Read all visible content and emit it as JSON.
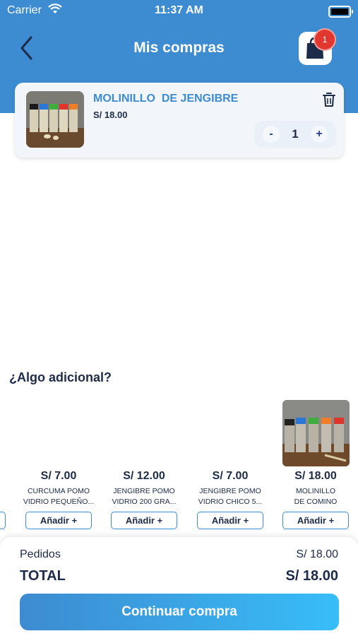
{
  "status_bar": {
    "carrier": "Carrier",
    "time": "11:37 AM"
  },
  "header": {
    "title": "Mis compras",
    "back_icon": "chevron-left-icon",
    "cart_icon": "shopping-bag-icon",
    "cart_count": "1"
  },
  "cart": {
    "items": [
      {
        "name": "MOLINILLO  DE JENGIBRE",
        "price": "S/ 18.00",
        "quantity": "1",
        "decrement": "-",
        "increment": "+"
      }
    ]
  },
  "suggestions": {
    "title": "¿Algo adicional?",
    "add_label": "Añadir +",
    "products": [
      {
        "price": "S/ 7.00",
        "name_line1": "CURCUMA POMO",
        "name_line2": "VIDRIO PEQUEÑO..."
      },
      {
        "price": "S/ 12.00",
        "name_line1": "JENGIBRE POMO",
        "name_line2": "VIDRIO 200 GRA..."
      },
      {
        "price": "S/ 7.00",
        "name_line1": "JENGIBRE POMO",
        "name_line2": "VIDRIO CHICO  5..."
      },
      {
        "price": "S/ 18.00",
        "name_line1": "MOLINILLO",
        "name_line2": "DE COMINO"
      }
    ]
  },
  "summary": {
    "orders_label": "Pedidos",
    "orders_value": "S/ 18.00",
    "total_label": "TOTAL",
    "total_value": "S/ 18.00"
  },
  "cta": {
    "label": "Continuar compra"
  },
  "colors": {
    "primary": "#3d8bd0",
    "text_dark": "#1d2b4a",
    "badge": "#e2372f",
    "stepper_text": "#2a3f92"
  }
}
